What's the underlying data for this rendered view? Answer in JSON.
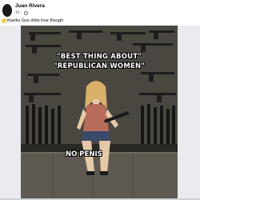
{
  "post": {
    "author": "Juan Rivera",
    "time": "1h",
    "audience_icon": "globe-icon",
    "caption": "thanks Gus shits true though",
    "caption_icon": "emoji-icon"
  },
  "meme": {
    "top_line_1": "\"BEST THING ABOUT\"",
    "top_line_2": "\"REPUBLICAN WOMEN\"",
    "bottom_text": "NO PENIS"
  },
  "colors": {
    "background": "#ffffff",
    "frame": "#e9ebee",
    "text_primary": "#050505",
    "text_secondary": "#65676b"
  }
}
